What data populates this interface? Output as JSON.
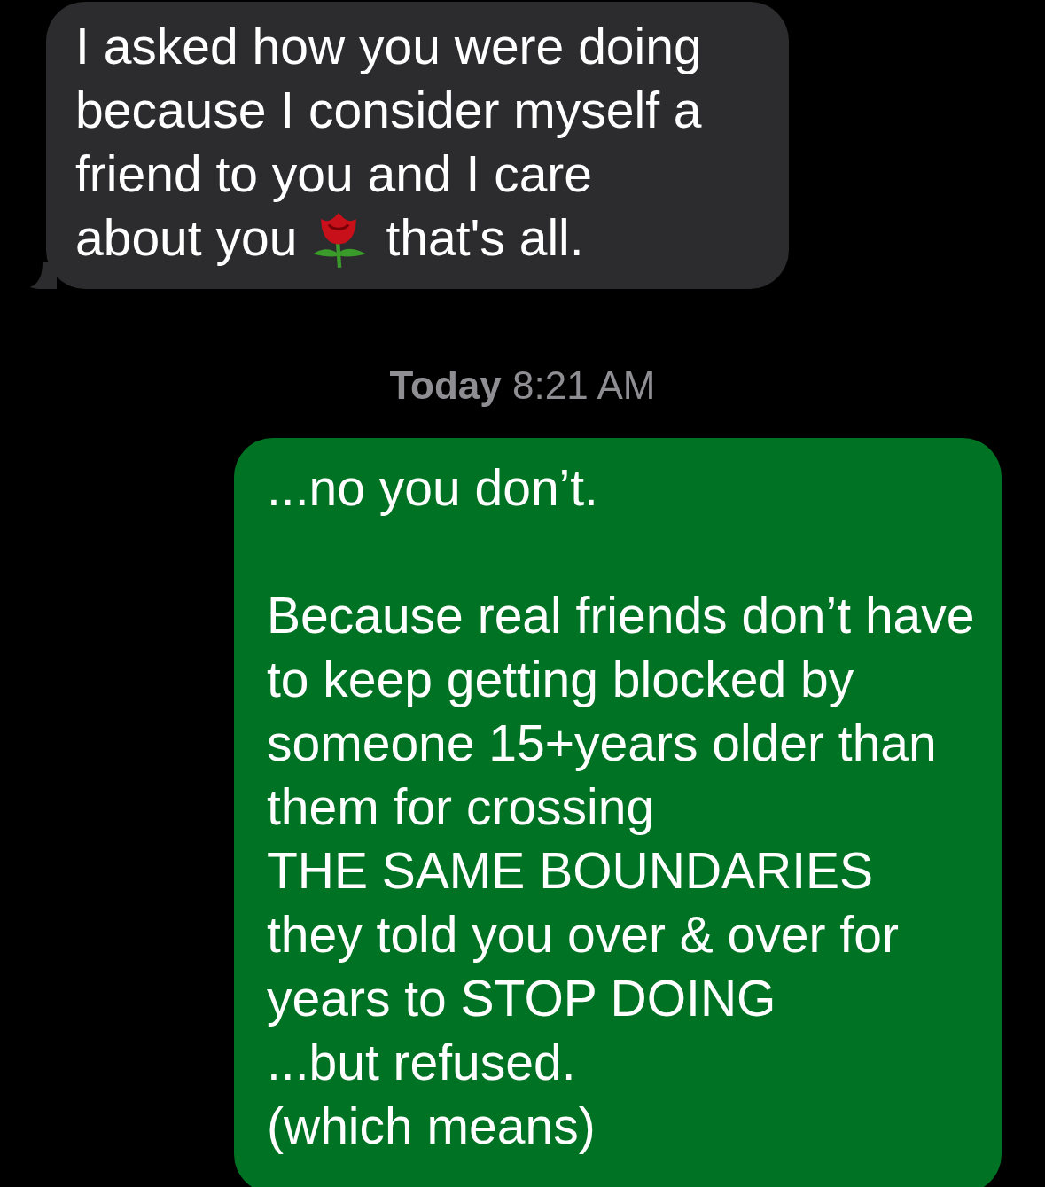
{
  "messages": [
    {
      "kind": "incoming",
      "parts": [
        {
          "kind": "paragraph",
          "text": "I asked how you were doing because I consider myself a friend to you and I care"
        },
        {
          "kind": "text",
          "text": "about you"
        },
        {
          "kind": "emoji"
        },
        {
          "kind": "text",
          "text": "that's all."
        }
      ]
    },
    {
      "kind": "timestamp",
      "text": "**Today** 8:21 AM"
    },
    {
      "kind": "outgoing",
      "paragraphs": [
        "...no you don’t.",
        "Because real friends don’t have to keep getting blocked by someone 15+years older than them for crossing\nTHE SAME BOUNDARIES they told you over & over for years to STOP DOING\n...but refused.\n(which means)"
      ]
    }
  ]
}
